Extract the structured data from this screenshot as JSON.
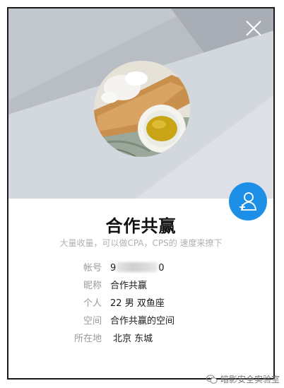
{
  "profile": {
    "name": "合作共赢",
    "signature": "大量收量，可以做CPA，CPS的 速度来撩下"
  },
  "details": {
    "account": {
      "label": "帐号",
      "prefix": "9",
      "suffix": "0"
    },
    "nickname": {
      "label": "昵称",
      "value": "合作共赢"
    },
    "personal": {
      "label": "个人",
      "age": "22",
      "gender": "男",
      "zodiac": "双鱼座"
    },
    "space": {
      "label": "空间",
      "value": "合作共赢的空间"
    },
    "location": {
      "label": "所在地",
      "city": "北京",
      "district": "东城"
    }
  },
  "icons": {
    "close": "close-icon",
    "add_friend": "add-friend-icon",
    "watermark": "wechat-icon"
  },
  "colors": {
    "accent": "#1e8fe6",
    "label": "#9a9a9a",
    "signature": "#b0b0b0"
  },
  "watermark": {
    "text": "暗影安全实验室"
  }
}
